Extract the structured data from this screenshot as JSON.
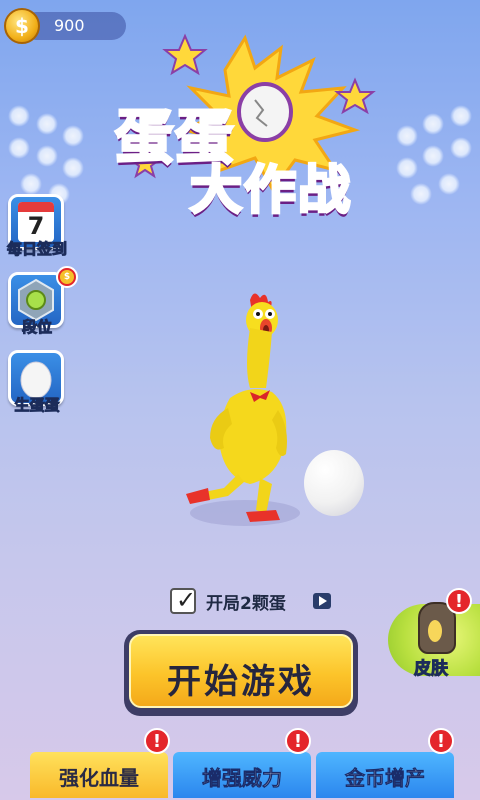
{
  "coins": {
    "value": "900",
    "icon": "dollar-coin-icon",
    "symbol": "$"
  },
  "logo": {
    "line1": "蛋蛋",
    "line2": "大作战"
  },
  "side_menu": [
    {
      "label": "每日签到",
      "icon": "calendar-icon",
      "calendar_day": "7"
    },
    {
      "label": "段位",
      "icon": "rank-badge-icon"
    },
    {
      "label": "生蛋蛋",
      "icon": "egg-icon"
    }
  ],
  "start_option": {
    "label": "开局2颗蛋",
    "checked": true,
    "icon": "video-ad-icon"
  },
  "start_button": {
    "label": "开始游戏"
  },
  "skin_button": {
    "label": "皮肤"
  },
  "alert_mark": "!",
  "upgrades": [
    {
      "label": "强化血量",
      "color": "#f9b92a"
    },
    {
      "label": "增强威力",
      "color": "#2b86ee"
    },
    {
      "label": "金币增产",
      "color": "#2b86ee"
    }
  ]
}
